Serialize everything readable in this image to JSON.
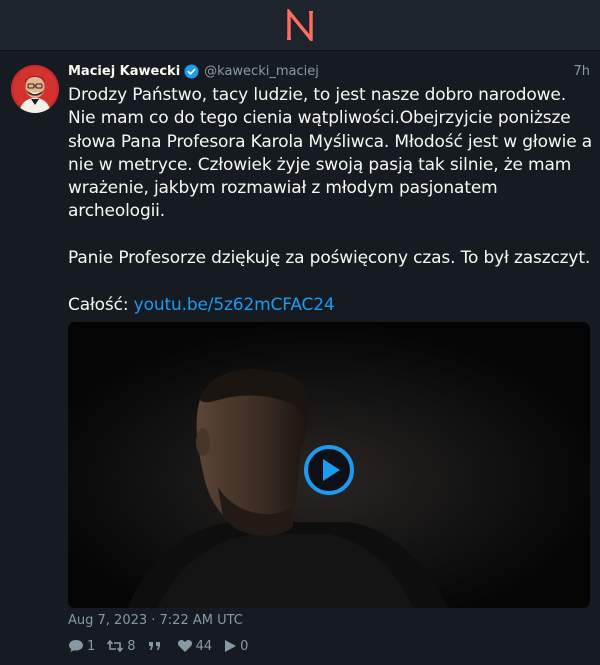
{
  "app": {
    "logo_letter": "N",
    "accent_color": "#ff6c60"
  },
  "tweet": {
    "fullname": "Maciej Kawecki",
    "username": "@kawecki_maciej",
    "time_ago": "7h",
    "verified": true,
    "paragraph1": "Drodzy Państwo, tacy ludzie, to jest nasze dobro narodowe. Nie mam co do tego cienia wątpliwości.Obejrzyjcie poniższe słowa Pana Profesora Karola Myśliwca. Młodość jest w głowie a nie w metryce. Człowiek żyje swoją pasją tak silnie, że mam wrażenie, jakbym rozmawiał z młodym pasjonatem archeologii.",
    "paragraph2": "Panie Profesorze dziękuję za poświęcony czas. To był zaszczyt.",
    "full_label": "Całość: ",
    "link_text": "youtu.be/5z62mCFAC24",
    "link_color": "#1d9bf0",
    "media": {
      "type": "video",
      "play_icon": "play-icon"
    },
    "date": "Aug 7, 2023 · 7:22 AM UTC",
    "stats": {
      "replies": "1",
      "retweets": "8",
      "quotes": "",
      "likes": "44",
      "views": "0"
    }
  }
}
